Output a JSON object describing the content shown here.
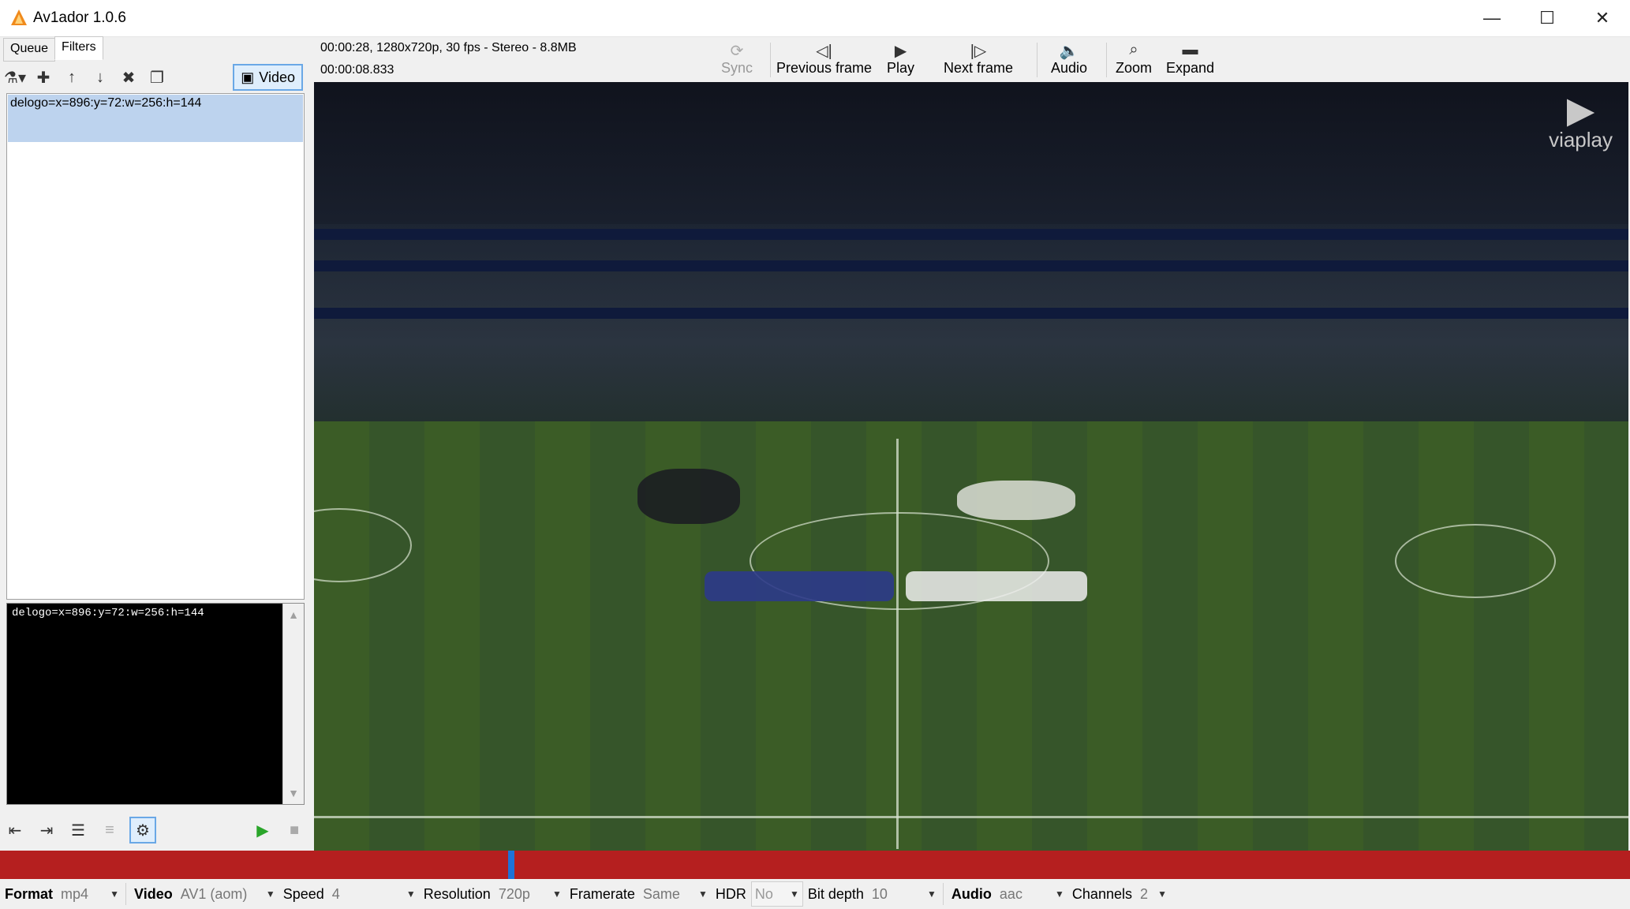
{
  "window": {
    "title": "Av1ador 1.0.6",
    "minimize": "—",
    "maximize": "☐",
    "close": "✕"
  },
  "tabs": [
    {
      "label": "Queue"
    },
    {
      "label": "Filters",
      "active": true
    }
  ],
  "left_toolbar": {
    "video_toggle_label": "Video"
  },
  "filters": {
    "items": [
      "delogo=x=896:y=72:w=256:h=144"
    ],
    "editor_text": "delogo=x=896:y=72:w=256:h=144"
  },
  "media_info": {
    "line1": "00:00:28, 1280x720p, 30 fps - Stereo - 8.8MB",
    "line2": "00:00:08.833"
  },
  "player_toolbar": {
    "sync": "Sync",
    "previous_frame": "Previous frame",
    "play": "Play",
    "next_frame": "Next frame",
    "audio": "Audio",
    "zoom": "Zoom",
    "expand": "Expand"
  },
  "video": {
    "watermark": "viaplay"
  },
  "timeline": {
    "color": "#b51f1f",
    "playhead_color": "#1e73d8"
  },
  "settings": {
    "format": {
      "label": "Format",
      "value": "mp4"
    },
    "video": {
      "label": "Video",
      "value": "AV1 (aom)"
    },
    "speed": {
      "label": "Speed",
      "value": "4"
    },
    "resolution": {
      "label": "Resolution",
      "value": "720p"
    },
    "framerate": {
      "label": "Framerate",
      "value": "Same"
    },
    "hdr": {
      "label": "HDR",
      "value": "No"
    },
    "bit_depth": {
      "label": "Bit depth",
      "value": "10"
    },
    "audio": {
      "label": "Audio",
      "value": "aac"
    },
    "channels": {
      "label": "Channels",
      "value": "2"
    }
  }
}
